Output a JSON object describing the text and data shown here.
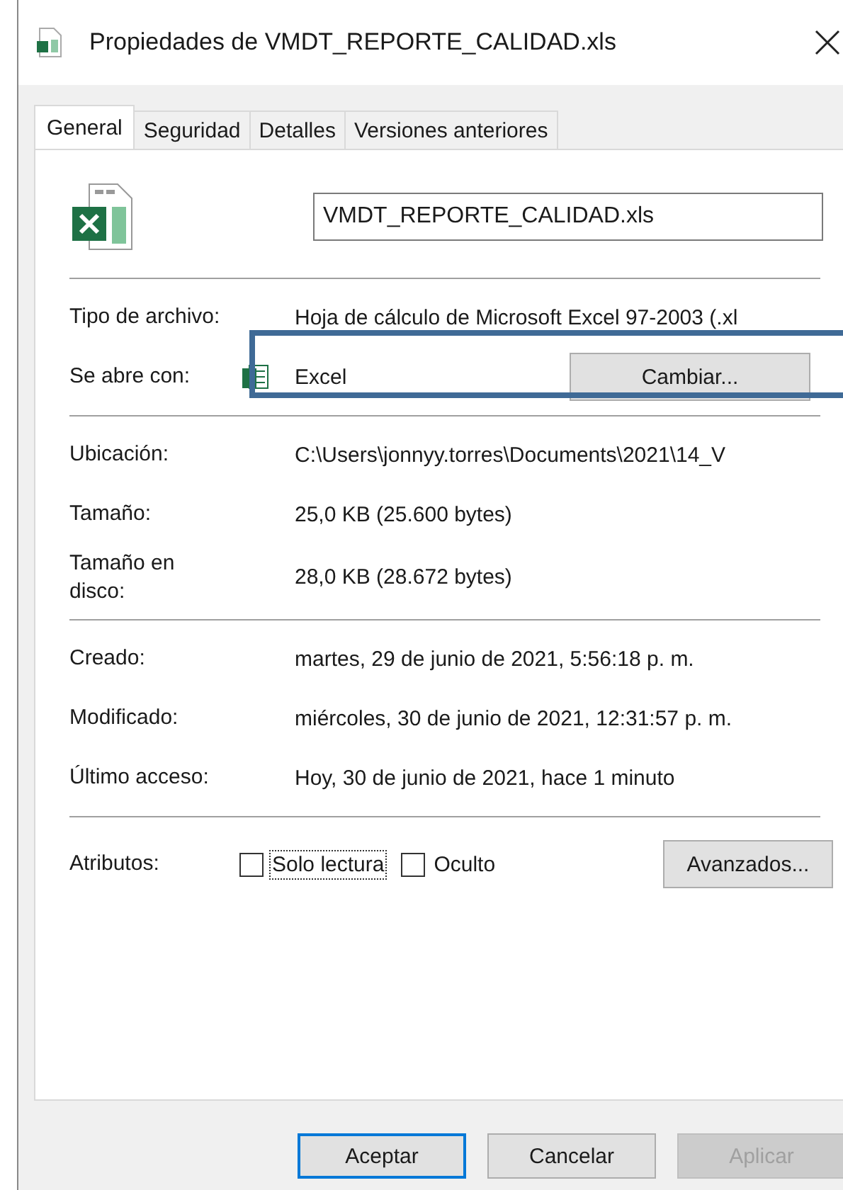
{
  "window": {
    "title": "Propiedades de VMDT_REPORTE_CALIDAD.xls"
  },
  "tabs": [
    {
      "label": "General",
      "selected": true
    },
    {
      "label": "Seguridad",
      "selected": false
    },
    {
      "label": "Detalles",
      "selected": false
    },
    {
      "label": "Versiones anteriores",
      "selected": false
    }
  ],
  "file_name": {
    "value": "VMDT_REPORTE_CALIDAD.xls"
  },
  "groups": [
    [
      {
        "kind": "text",
        "label": "Tipo de archivo:",
        "value": "Hoja de cálculo de Microsoft Excel 97-2003 (.xl"
      },
      {
        "kind": "app",
        "label": "Se abre con:",
        "value": "Excel",
        "button": "Cambiar..."
      }
    ],
    [
      {
        "kind": "text",
        "label": "Ubicación:",
        "value": "C:\\Users\\jonnyy.torres\\Documents\\2021\\14_V"
      },
      {
        "kind": "text",
        "label": "Tamaño:",
        "value": "25,0 KB (25.600 bytes)"
      },
      {
        "kind": "text",
        "label": "Tamaño en disco:",
        "value": "28,0 KB (28.672 bytes)"
      }
    ],
    [
      {
        "kind": "text",
        "label": "Creado:",
        "value": "martes, 29 de junio de 2021, 5:56:18 p. m."
      },
      {
        "kind": "text",
        "label": "Modificado:",
        "value": "miércoles, 30 de junio de 2021, 12:31:57 p. m."
      },
      {
        "kind": "text",
        "label": "Último acceso:",
        "value": "Hoy, 30 de junio de 2021, hace 1 minuto"
      }
    ]
  ],
  "attributes": {
    "label": "Atributos:",
    "checkboxes": [
      {
        "label": "Solo lectura",
        "checked": false,
        "focused": true
      },
      {
        "label": "Oculto",
        "checked": false,
        "focused": false
      }
    ],
    "button": "Avanzados..."
  },
  "buttons": [
    {
      "label": "Aceptar",
      "default": true,
      "disabled": false
    },
    {
      "label": "Cancelar",
      "default": false,
      "disabled": false
    },
    {
      "label": "Aplicar",
      "default": false,
      "disabled": true
    }
  ]
}
